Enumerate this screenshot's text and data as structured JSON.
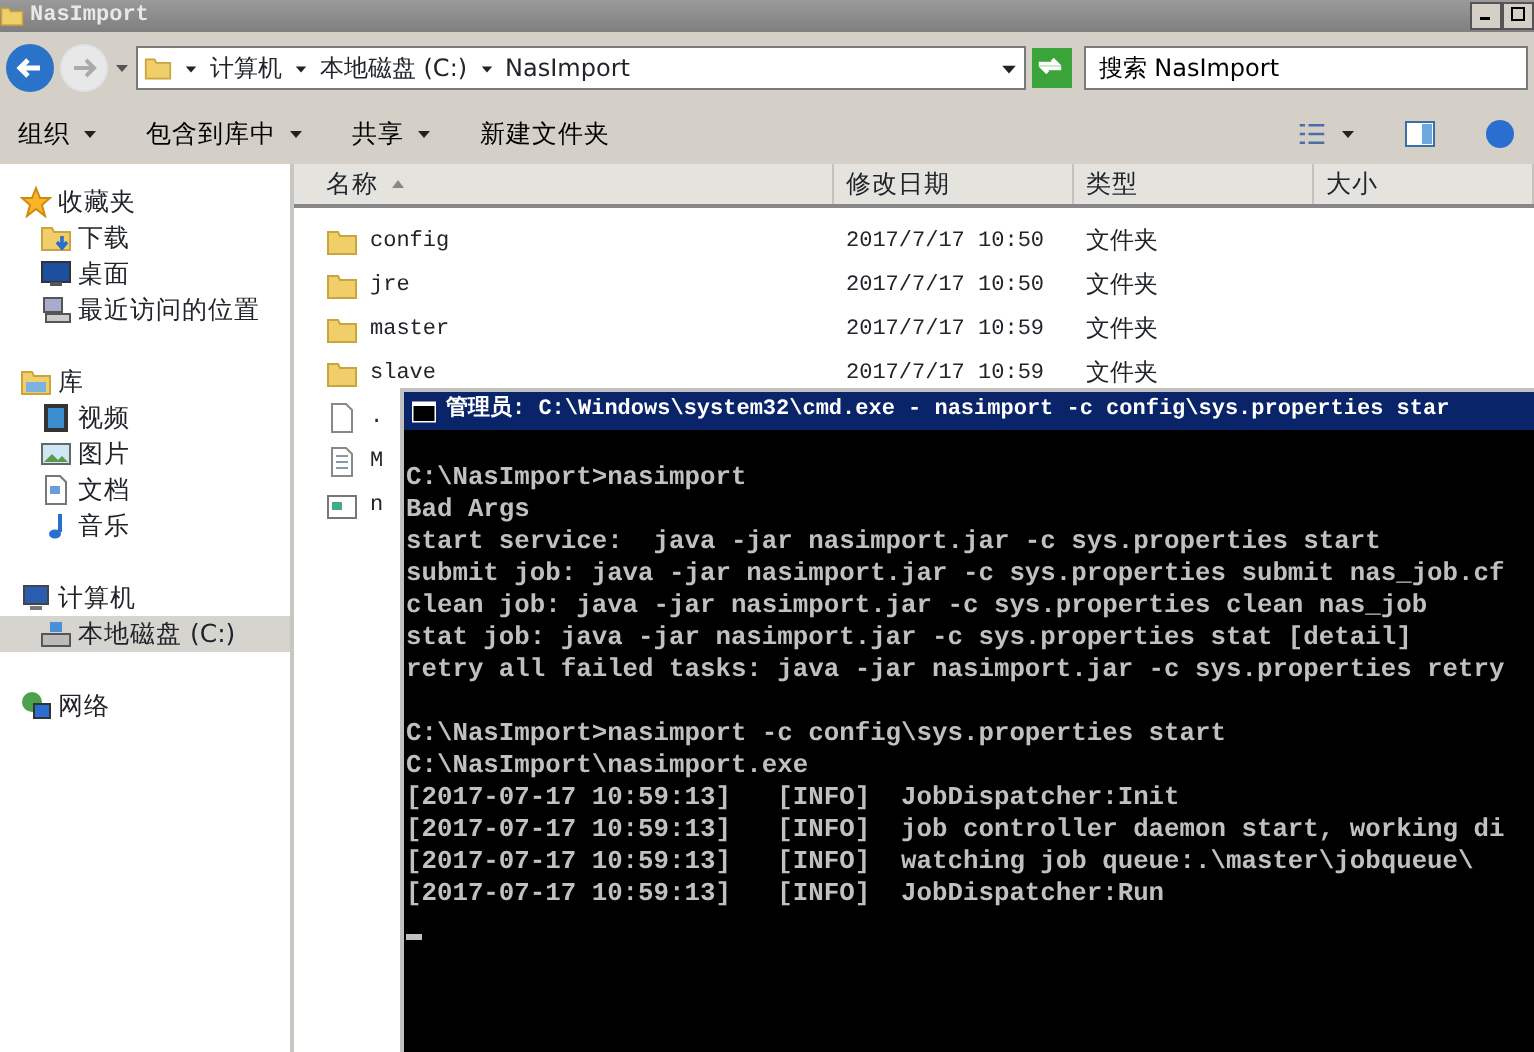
{
  "window": {
    "title": "NasImport"
  },
  "address_bar": {
    "breadcrumbs": [
      "计算机",
      "本地磁盘 (C:)",
      "NasImport"
    ]
  },
  "search": {
    "placeholder": "搜索 NasImport"
  },
  "toolbar": [
    {
      "label": "组织",
      "dropdown": true
    },
    {
      "label": "包含到库中",
      "dropdown": true
    },
    {
      "label": "共享",
      "dropdown": true
    },
    {
      "label": "新建文件夹",
      "dropdown": false
    }
  ],
  "sidebar": {
    "items": [
      {
        "label": "收藏夹",
        "kind": "star",
        "selected": false,
        "children": [
          {
            "label": "下载",
            "kind": "download",
            "selected": false
          },
          {
            "label": "桌面",
            "kind": "desktop",
            "selected": false
          },
          {
            "label": "最近访问的位置",
            "kind": "recent",
            "selected": false
          }
        ]
      },
      {
        "label": "库",
        "kind": "library",
        "selected": false,
        "children": [
          {
            "label": "视频",
            "kind": "video",
            "selected": false
          },
          {
            "label": "图片",
            "kind": "picture",
            "selected": false
          },
          {
            "label": "文档",
            "kind": "document",
            "selected": false
          },
          {
            "label": "音乐",
            "kind": "music",
            "selected": false
          }
        ]
      },
      {
        "label": "计算机",
        "kind": "computer",
        "selected": false,
        "children": [
          {
            "label": "本地磁盘 (C:)",
            "kind": "drive",
            "selected": true
          }
        ]
      },
      {
        "label": "网络",
        "kind": "network",
        "selected": false
      }
    ]
  },
  "file_list": {
    "columns": [
      {
        "label": "名称",
        "sorted": true
      },
      {
        "label": "修改日期",
        "sorted": false
      },
      {
        "label": "类型",
        "sorted": false
      },
      {
        "label": "大小",
        "sorted": false
      }
    ],
    "rows": [
      {
        "name": "config",
        "modified": "2017/7/17 10:50",
        "type": "文件夹",
        "kind": "folder"
      },
      {
        "name": "jre",
        "modified": "2017/7/17 10:50",
        "type": "文件夹",
        "kind": "folder"
      },
      {
        "name": "master",
        "modified": "2017/7/17 10:59",
        "type": "文件夹",
        "kind": "folder"
      },
      {
        "name": "slave",
        "modified": "2017/7/17 10:59",
        "type": "文件夹",
        "kind": "folder"
      },
      {
        "name": ".",
        "kind": "file"
      },
      {
        "name": "M",
        "kind": "text"
      },
      {
        "name": "n",
        "kind": "app"
      }
    ]
  },
  "console": {
    "title": "管理员: C:\\Windows\\system32\\cmd.exe - nasimport  -c config\\sys.properties star",
    "blocks": [
      [
        "C:\\NasImport>nasimport",
        "Bad Args",
        "start service:  java -jar nasimport.jar -c sys.properties start",
        "submit job: java -jar nasimport.jar -c sys.properties submit nas_job.cf",
        "clean job: java -jar nasimport.jar -c sys.properties clean nas_job",
        "stat job: java -jar nasimport.jar -c sys.properties stat [detail]",
        "retry all failed tasks: java -jar nasimport.jar -c sys.properties retry"
      ],
      [
        "C:\\NasImport>nasimport -c config\\sys.properties start",
        "C:\\NasImport\\nasimport.exe",
        "[2017-07-17 10:59:13]   [INFO]  JobDispatcher:Init",
        "[2017-07-17 10:59:13]   [INFO]  job controller daemon start, working di",
        "[2017-07-17 10:59:13]   [INFO]  watching job queue:.\\master\\jobqueue\\",
        "[2017-07-17 10:59:13]   [INFO]  JobDispatcher:Run"
      ]
    ],
    "cursor": true
  }
}
